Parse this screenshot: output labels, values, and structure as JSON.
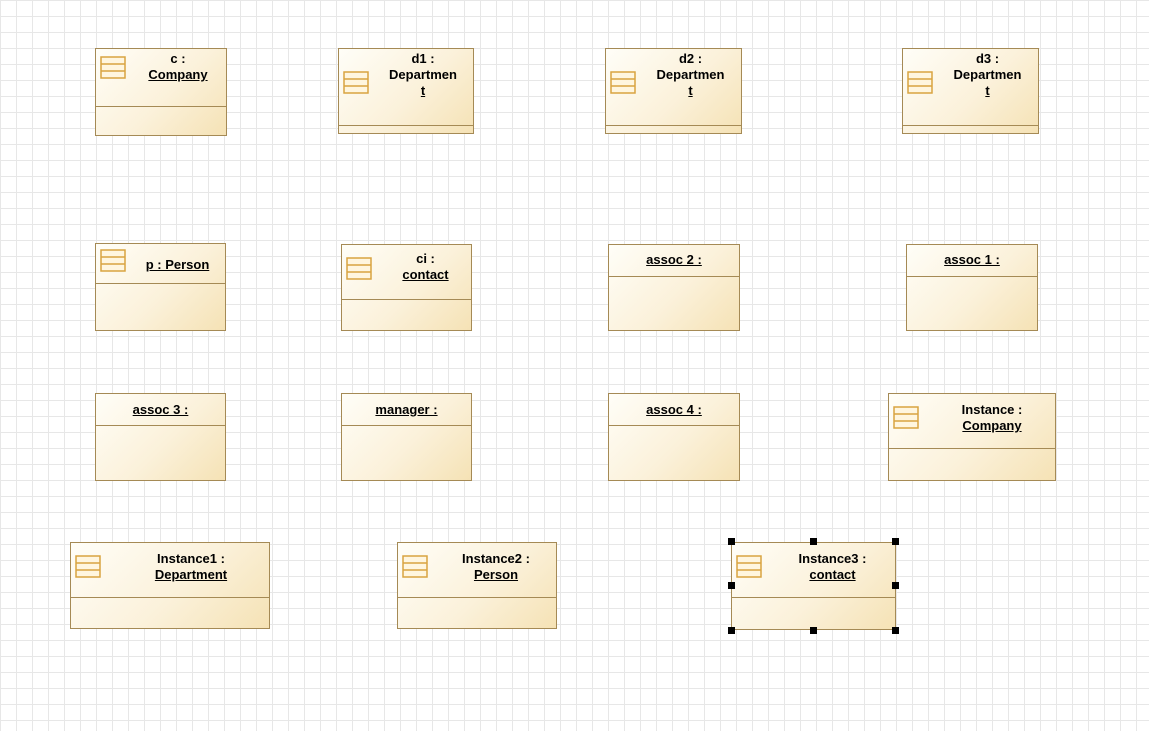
{
  "diagram": {
    "objects": [
      {
        "id": "c",
        "line1": "c :",
        "line2": "Company"
      },
      {
        "id": "d1",
        "line1": "d1 :",
        "line2": "Departmen",
        "line3": "t"
      },
      {
        "id": "d2",
        "line1": "d2 :",
        "line2": "Departmen",
        "line3": "t"
      },
      {
        "id": "d3",
        "line1": "d3 :",
        "line2": "Departmen",
        "line3": "t"
      },
      {
        "id": "p",
        "line1": "p : Person"
      },
      {
        "id": "ci",
        "line1": "ci :",
        "line2": "contact"
      },
      {
        "id": "assoc2",
        "line1": "assoc 2 :"
      },
      {
        "id": "assoc1",
        "line1": "assoc 1 :"
      },
      {
        "id": "assoc3",
        "line1": "assoc 3 :"
      },
      {
        "id": "manager",
        "line1": "manager :"
      },
      {
        "id": "assoc4",
        "line1": "assoc 4 :"
      },
      {
        "id": "instance",
        "line1": "Instance :",
        "line2": "Company"
      },
      {
        "id": "instance1",
        "line1": "Instance1 :",
        "line2": "Department"
      },
      {
        "id": "instance2",
        "line1": "Instance2 :",
        "line2": "Person"
      },
      {
        "id": "instance3",
        "line1": "Instance3 :",
        "line2": "contact",
        "selected": true
      }
    ]
  },
  "colors": {
    "border": "#a58a55",
    "icon_stroke": "#d9a441",
    "grid": "#e7e7e7"
  },
  "icons": {
    "object": "instance-spec-icon"
  }
}
